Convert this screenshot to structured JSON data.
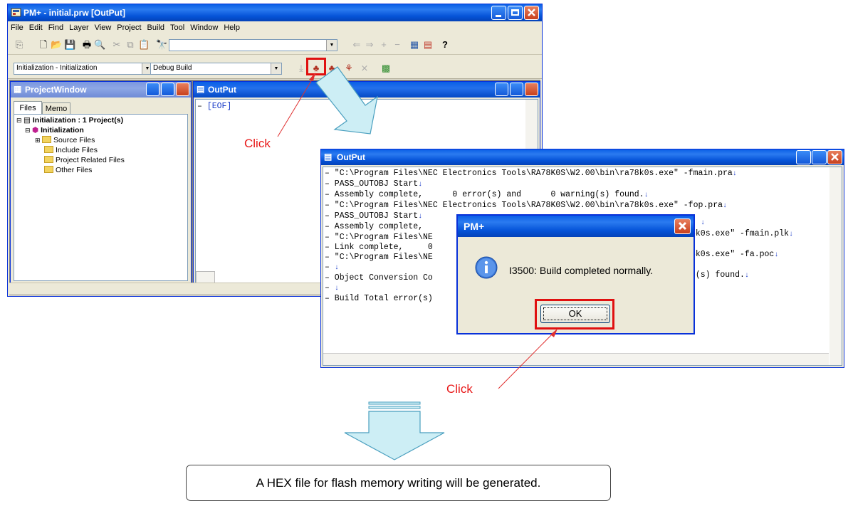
{
  "main_window": {
    "title": "PM+ - initial.prw [OutPut]",
    "menu": [
      "File",
      "Edit",
      "Find",
      "Layer",
      "View",
      "Project",
      "Build",
      "Tool",
      "Window",
      "Help"
    ],
    "project_combo": "Initialization - Initialization",
    "build_combo": "Debug Build"
  },
  "project_window": {
    "title": "ProjectWindow",
    "tabs": [
      "Files",
      "Memo"
    ],
    "tree": {
      "root": "Initialization : 1 Project(s)",
      "project": "Initialization",
      "folders": [
        "Source Files",
        "Include Files",
        "Project Related Files",
        "Other Files"
      ]
    }
  },
  "output_small": {
    "title": "OutPut",
    "line": "[EOF]"
  },
  "output_large": {
    "title": "OutPut",
    "lines": [
      "\"C:\\Program Files\\NEC Electronics Tools\\RA78K0S\\W2.00\\bin\\ra78k0s.exe\" -fmain.pra",
      "PASS_OUTOBJ Start",
      "Assembly complete,      0 error(s) and      0 warning(s) found.",
      "\"C:\\Program Files\\NEC Electronics Tools\\RA78K0S\\W2.00\\bin\\ra78k0s.exe\" -fop.pra",
      "PASS_OUTOBJ Start",
      "Assembly complete,",
      "\"C:\\Program Files\\NE",
      "Link complete,     0",
      "\"C:\\Program Files\\NE",
      "",
      "Object Conversion Co",
      "",
      "Build Total error(s)"
    ],
    "right_fragments": [
      "",
      "",
      "",
      "",
      "",
      "",
      "8k0s.exe\" -fmain.plk",
      "",
      "8k0s.exe\" -fa.poc",
      "",
      "g(s) found.",
      "",
      ""
    ]
  },
  "dialog": {
    "title": "PM+",
    "message": "I3500: Build completed normally.",
    "ok_label": "OK"
  },
  "callouts": {
    "click_top": "Click",
    "click_bottom": "Click"
  },
  "note": "A HEX file for flash memory writing will be generated.",
  "colors": {
    "title_blue": "#0553d8",
    "highlight_red": "#e01010",
    "arrow_fill": "#cdeef5",
    "arrow_stroke": "#4a9fbf"
  }
}
